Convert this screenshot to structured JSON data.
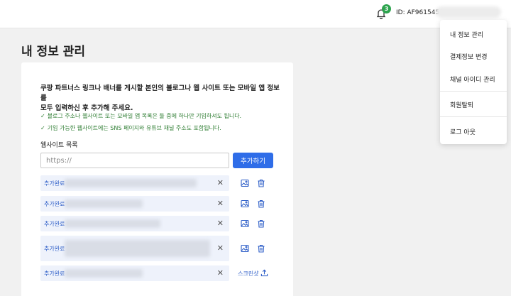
{
  "header": {
    "notification_count": "3",
    "user_id": "ID: AF9615456"
  },
  "page": {
    "title": "내 정보 관리"
  },
  "card": {
    "intro_line1": "쿠팡 파트너스 링크나 배너를 게시할 본인의 블로그나 웹 사이트 또는 모바일 앱 정보를",
    "intro_line2": "모두 입력하신 후 추가해 주세요.",
    "check1": "블로그 주소나 웹사이트 또는 모바일 앱 목록은 둘 중에 하나만 기입하셔도 됩니다.",
    "check2": "기입 가능한 웹사이트에는 SNS 페이지와 유튜브 채널 주소도 포함됩니다.",
    "list_label": "웹사이트 목록",
    "input_placeholder": "https://",
    "add_button": "추가하기",
    "screenshot_label": "스크린샷",
    "rows": [
      {
        "status": "추가완료"
      },
      {
        "status": "추가완료"
      },
      {
        "status": "추가완료"
      },
      {
        "status": "추가완료"
      },
      {
        "status": "추가완료"
      }
    ]
  },
  "dropdown": {
    "items": [
      "내 정보 관리",
      "결제정보 변경",
      "채널 아이디 관리",
      "회원탈퇴",
      "로그 아웃"
    ]
  },
  "colors": {
    "accent": "#2f6de8",
    "check_green": "#2e7d32",
    "badge_green": "#2da44e",
    "row_bg": "#eef2fb"
  }
}
